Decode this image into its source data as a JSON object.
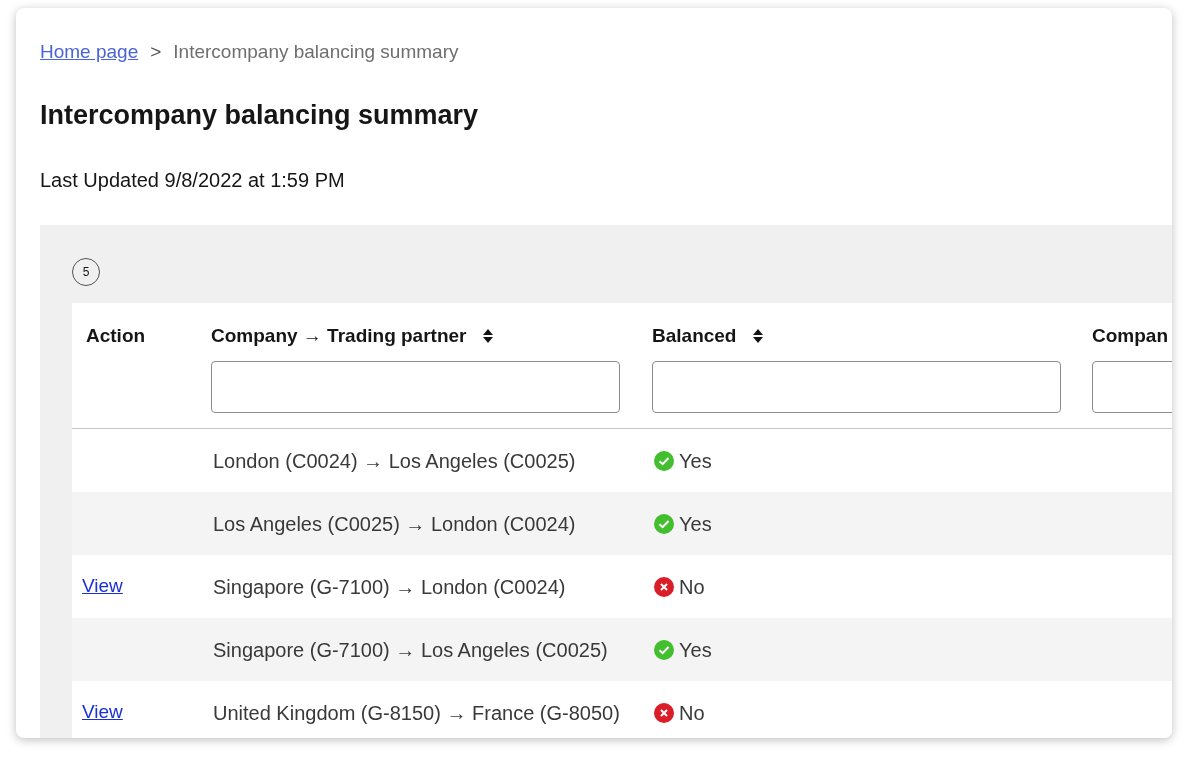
{
  "breadcrumb": {
    "link": "Home page",
    "separator": ">",
    "current": "Intercompany balancing summary"
  },
  "title": "Intercompany balancing summary",
  "last_updated": "Last Updated 9/8/2022 at 1:59 PM",
  "count_badge": "5",
  "table": {
    "columns": [
      {
        "label": "Action",
        "kind": "plain"
      },
      {
        "label": "Company → Trading partner",
        "kind": "sortable"
      },
      {
        "label": "Balanced",
        "kind": "sortable"
      },
      {
        "label": "Compan",
        "kind": "filter"
      }
    ],
    "rows": [
      {
        "action": null,
        "pair": "London (C0024) → Los Angeles (C0025)",
        "balanced": true,
        "balanced_label": "Yes"
      },
      {
        "action": null,
        "pair": "Los Angeles (C0025) → London (C0024)",
        "balanced": true,
        "balanced_label": "Yes"
      },
      {
        "action": "View",
        "pair": "Singapore (G-7100) → London (C0024)",
        "balanced": false,
        "balanced_label": "No"
      },
      {
        "action": null,
        "pair": "Singapore (G-7100) → Los Angeles (C0025)",
        "balanced": true,
        "balanced_label": "Yes"
      },
      {
        "action": "View",
        "pair": "United Kingdom (G-8150) → France (G-8050)",
        "balanced": false,
        "balanced_label": "No"
      }
    ]
  }
}
